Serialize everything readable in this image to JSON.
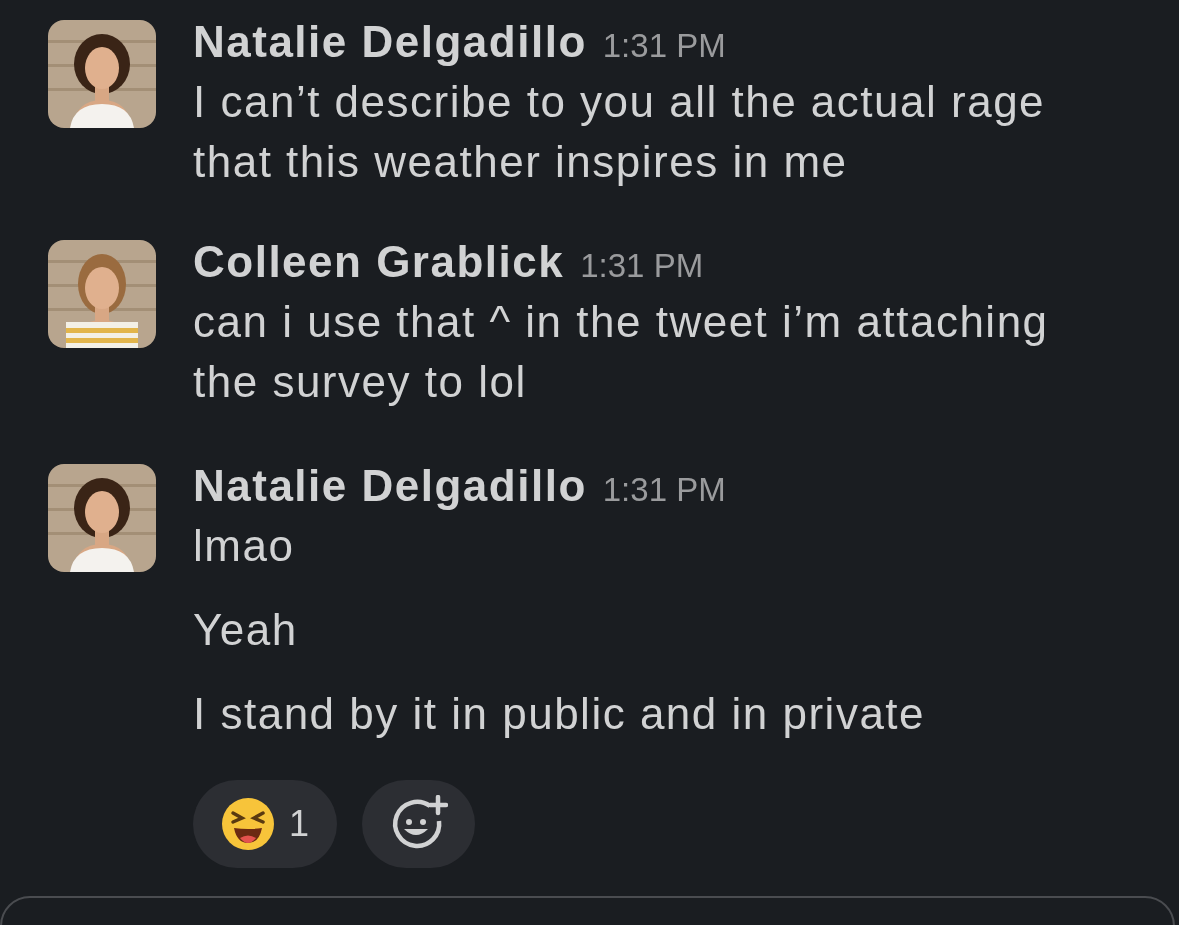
{
  "messages": [
    {
      "author": "Natalie Delgadillo",
      "time": "1:31 PM",
      "paragraphs": [
        "I can’t describe to you all the actual rage that this weather inspires in me"
      ]
    },
    {
      "author": "Colleen Grablick",
      "time": "1:31 PM",
      "paragraphs": [
        "can i use that ^ in the tweet i’m attaching the survey to lol"
      ]
    },
    {
      "author": "Natalie Delgadillo",
      "time": "1:31 PM",
      "paragraphs": [
        "lmao",
        "Yeah",
        "I stand by it in public and in private"
      ],
      "reactions": [
        {
          "count": "1"
        }
      ]
    }
  ]
}
